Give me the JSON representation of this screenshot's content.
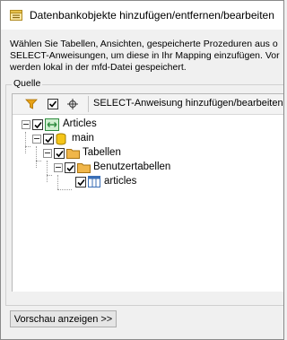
{
  "window": {
    "title": "Datenbankobjekte hinzufügen/entfernen/bearbeiten"
  },
  "intro": {
    "line1": "Wählen Sie Tabellen, Ansichten, gespeicherte Prozeduren aus o",
    "line2": "SELECT-Anweisungen, um diese in Ihr Mapping einzufügen. Vor",
    "line3": "werden lokal in der mfd-Datei gespeichert."
  },
  "source_group": {
    "label": "Quelle",
    "toolbar": {
      "filter_icon": "filter-icon",
      "check_icon": "checkmark-icon",
      "locate_icon": "crosshair-icon",
      "select_label": "SELECT-Anweisung hinzufügen/bearbeiten"
    },
    "tree": [
      {
        "label": "Articles",
        "icon": "database-icon",
        "checked": true
      },
      {
        "label": "main",
        "icon": "schema-icon",
        "checked": true
      },
      {
        "label": "Tabellen",
        "icon": "folder-icon",
        "checked": true
      },
      {
        "label": "Benutzertabellen",
        "icon": "folder-icon",
        "checked": true
      },
      {
        "label": "articles",
        "icon": "table-icon",
        "checked": true
      }
    ]
  },
  "footer": {
    "preview_button": "Vorschau anzeigen >>"
  },
  "colors": {
    "folder": "#f0b64a",
    "schema": "#f5c518",
    "database": "#3aa655",
    "table": "#3b6fb6",
    "filter": "#e8a317"
  }
}
